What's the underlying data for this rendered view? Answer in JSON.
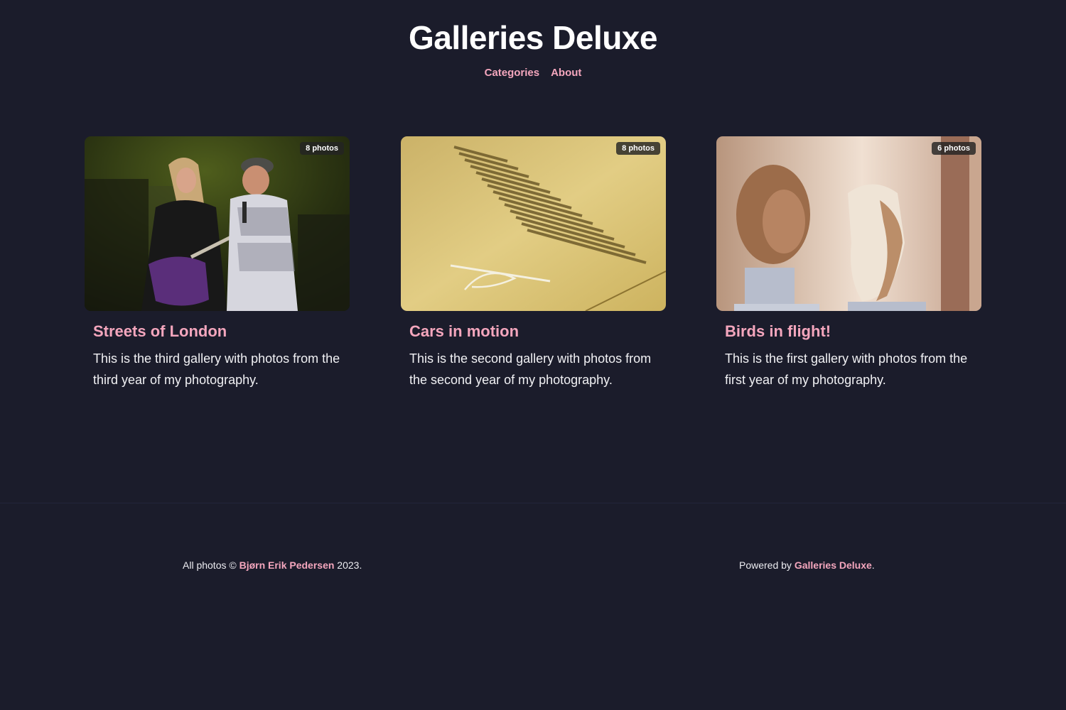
{
  "site": {
    "title": "Galleries Deluxe"
  },
  "nav": {
    "items": [
      {
        "label": "Categories"
      },
      {
        "label": "About"
      }
    ]
  },
  "galleries": [
    {
      "title": "Streets of London",
      "count": "8 photos",
      "description": "This is the third gallery with photos from the third year of my photography."
    },
    {
      "title": "Cars in motion",
      "count": "8 photos",
      "description": "This is the second gallery with photos from the second year of my photography."
    },
    {
      "title": "Birds in flight!",
      "count": "6 photos",
      "description": "This is the first gallery with photos from the first year of my photography."
    }
  ],
  "footer": {
    "copyright_prefix": "All photos ©",
    "author": "Bjørn Erik Pedersen",
    "year_suffix": "2023.",
    "powered_prefix": "Powered by",
    "powered_link": "Galleries Deluxe",
    "powered_suffix": "."
  },
  "colors": {
    "background": "#1b1c2b",
    "accent": "#f4a6bd",
    "text": "#ffffff"
  }
}
